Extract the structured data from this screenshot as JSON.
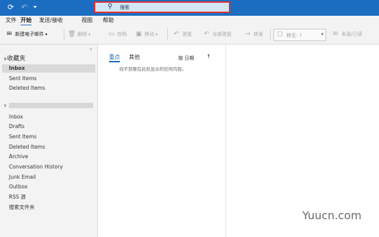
{
  "titlebar": {
    "sync_icon": "refresh-icon",
    "undo_icon": "undo-icon",
    "customize_icon": "customize-arrow-icon",
    "search_placeholder": "搜索"
  },
  "menu": [
    "文件",
    "开始",
    "发送/接收",
    "视图",
    "帮助"
  ],
  "ribbon": {
    "new_email": "新建电子邮件",
    "delete": "删除",
    "archive": "存档",
    "move": "移动",
    "reply": "答复",
    "reply_all": "全部答复",
    "forward": "转发",
    "quickstep": "移至: ?",
    "unread_read": "未读/已读"
  },
  "favorites": {
    "header": "收藏夹",
    "items": [
      "Inbox",
      "Sent Items",
      "Deleted Items"
    ]
  },
  "account_folders": [
    "Inbox",
    "Drafts",
    "Sent Items",
    "Deleted Items",
    "Archive",
    "Conversation History",
    "Junk Email",
    "Outbox",
    "RSS 源",
    "搜索文件夹"
  ],
  "list": {
    "tab_focused": "重点",
    "tab_other": "其他",
    "sort_label": "按 日期",
    "empty_message": "找不到要在此处显示的任何内容。"
  },
  "watermark": "Yuucn.com",
  "colors": {
    "accent": "#1b6dc1",
    "highlight": "#e0312c"
  }
}
